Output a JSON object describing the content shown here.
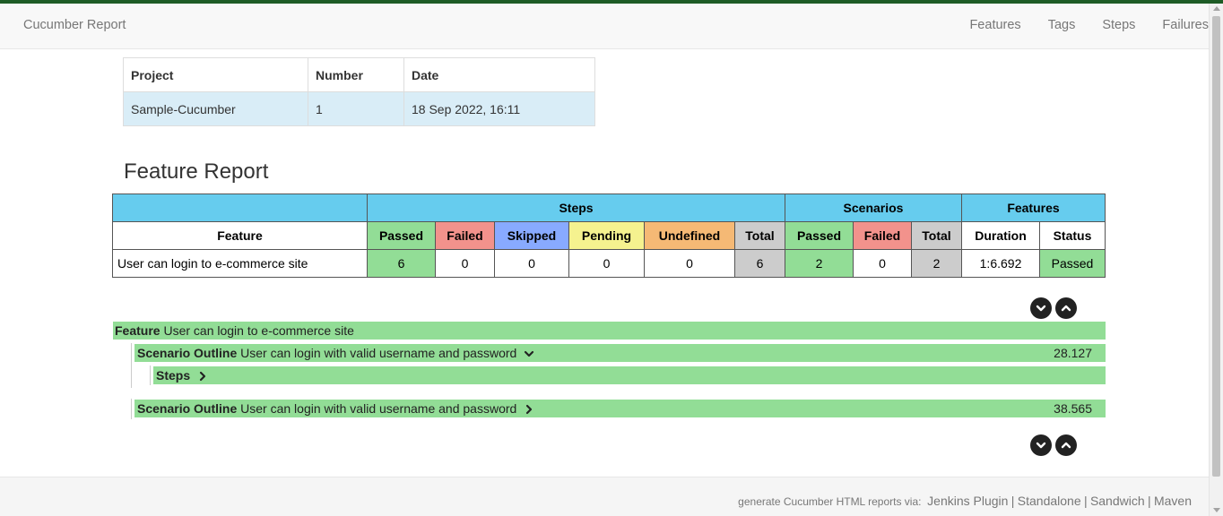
{
  "navbar": {
    "brand": "Cucumber Report",
    "links": [
      "Features",
      "Tags",
      "Steps",
      "Failures"
    ]
  },
  "info_table": {
    "headers": [
      "Project",
      "Number",
      "Date"
    ],
    "row": [
      "Sample-Cucumber",
      "1",
      "18 Sep 2022, 16:11"
    ]
  },
  "report_title": "Feature Report",
  "stats": {
    "group_headers": {
      "steps": "Steps",
      "scenarios": "Scenarios",
      "features": "Features"
    },
    "columns": [
      "Feature",
      "Passed",
      "Failed",
      "Skipped",
      "Pending",
      "Undefined",
      "Total",
      "Passed",
      "Failed",
      "Total",
      "Duration",
      "Status"
    ],
    "row": {
      "feature": "User can login to e-commerce site",
      "steps_passed": "6",
      "steps_failed": "0",
      "steps_skipped": "0",
      "steps_pending": "0",
      "steps_undefined": "0",
      "steps_total": "6",
      "scenarios_passed": "2",
      "scenarios_failed": "0",
      "scenarios_total": "2",
      "duration": "1:6.692",
      "status": "Passed"
    }
  },
  "feature_details": {
    "feature_keyword": "Feature",
    "feature_name": "User can login to e-commerce site",
    "scenarios": [
      {
        "keyword": "Scenario Outline",
        "name": "User can login with valid username and password",
        "duration": "28.127",
        "expanded": true
      },
      {
        "keyword": "Scenario Outline",
        "name": "User can login with valid username and password",
        "duration": "38.565",
        "expanded": false
      }
    ],
    "steps_label": "Steps"
  },
  "footer": {
    "prefix": "generate Cucumber HTML reports via:",
    "links": [
      "Jenkins Plugin",
      "Standalone",
      "Sandwich",
      "Maven"
    ],
    "separator": "|"
  },
  "colors": {
    "passed": "#92dd96",
    "failed": "#f2928c",
    "skipped": "#88aaff",
    "pending": "#f5f28f",
    "undefined": "#f5b975",
    "total": "#cccccc",
    "header": "#66ccee",
    "accent": "#1e5c26"
  }
}
